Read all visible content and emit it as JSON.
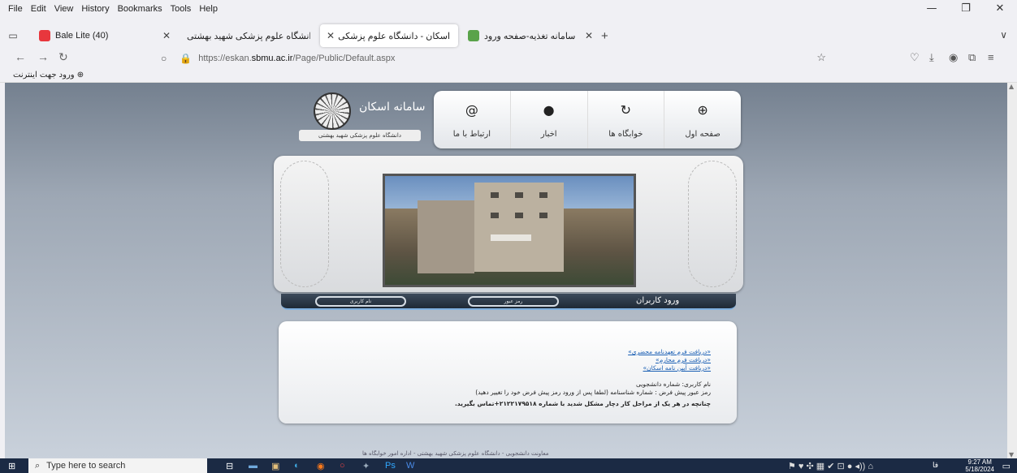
{
  "menu": [
    "File",
    "Edit",
    "View",
    "History",
    "Bookmarks",
    "Tools",
    "Help"
  ],
  "window_controls": {
    "minimize": "—",
    "restore": "❐",
    "close": "✕"
  },
  "tabs": [
    {
      "title": "Bale Lite (40)",
      "favicon_color": "#e8373d"
    },
    {
      "title": "دانشگاه علوم پزشکی شهید بهشتی | ...",
      "favicon_color": "#cccccc"
    },
    {
      "title": "سامانه اسکان - دانشگاه علوم پزشکی",
      "favicon_color": "#cccccc"
    },
    {
      "title": "سامانه تغذیه-صفحه ورود",
      "favicon_color": "#5aa34a"
    }
  ],
  "close_glyph": "✕",
  "new_tab": "+",
  "tab_list": "∨",
  "url": {
    "prefix": "https://eskan.",
    "domain": "sbmu.ac.ir",
    "path": "/Page/Public/Default.aspx"
  },
  "bookmark": "ورود جهت اینترنت ⊕",
  "site": {
    "title": "سامانه اسکان",
    "subtitle": "دانشگاه علوم پزشکی شهید بهشتی",
    "nav": [
      {
        "label": "ارتباط با ما",
        "icon": "@"
      },
      {
        "label": "اخبار",
        "icon": "●"
      },
      {
        "label": "خوابگاه ها",
        "icon": "↻"
      },
      {
        "label": "صفحه اول",
        "icon": "⊕"
      }
    ],
    "login": {
      "heading": "ورود کاربران",
      "username_placeholder": "نام کاربری",
      "password_placeholder": "رمز عبور"
    },
    "info": {
      "links": [
        "«دریافت فرم تعهدنامه محضری»",
        "«دریافت فرم محارم»",
        "«دریافت آیین نامه اسکان»"
      ],
      "username_note": "نام کاربری: شماره دانشجویی",
      "password_note": "رمز عبور پیش فرض : شماره شناسنامه (لطفا پس از ورود رمز پیش فرض خود را تغییر دهید)",
      "contact_note": "چنانچه در هر یک از مراحل کار دچار مشکل شدید با شماره ۲۱۲۲۱۷۹۵۱۸+تماس بگیرید."
    },
    "footer": "معاونت دانشجویی - دانشگاه علوم پزشکی شهید بهشتی - اداره امور خوابگاه ها"
  },
  "taskbar": {
    "search_placeholder": "Type here to search",
    "time": "9:27 AM",
    "date": "5/18/2024",
    "lang": "فا"
  },
  "colors": {
    "accent_link": "#1a5fb4",
    "taskbar": "#1b2a44"
  }
}
